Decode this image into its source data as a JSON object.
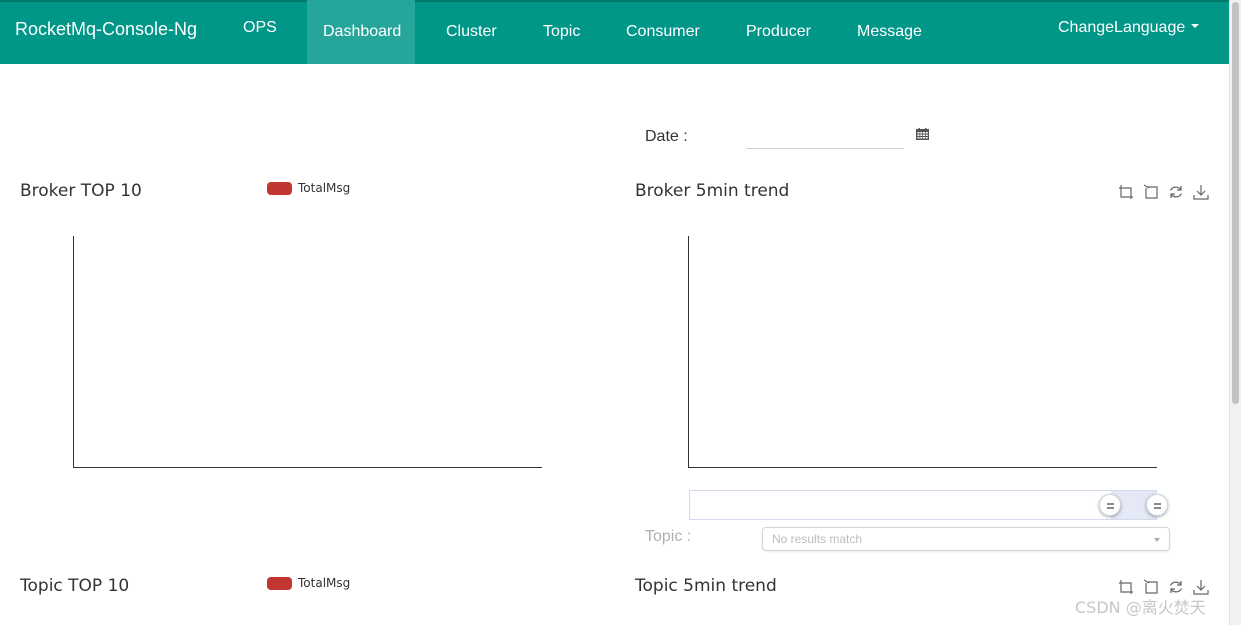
{
  "navbar": {
    "brand": "RocketMq-Console-Ng",
    "items": [
      {
        "label": "OPS"
      },
      {
        "label": "Dashboard",
        "active": true
      },
      {
        "label": "Cluster"
      },
      {
        "label": "Topic"
      },
      {
        "label": "Consumer"
      },
      {
        "label": "Producer"
      },
      {
        "label": "Message"
      }
    ],
    "language": "ChangeLanguage",
    "color": "#009688",
    "active_color": "#26a69a"
  },
  "date": {
    "label": "Date :",
    "value": "",
    "icon": "calendar-icon"
  },
  "charts": {
    "broker_top": {
      "title": "Broker TOP 10",
      "legend": "TotalMsg",
      "legend_color": "#c23531"
    },
    "broker_trend": {
      "title": "Broker 5min trend",
      "toolbox": [
        "zoom-icon",
        "zoom-reset-icon",
        "refresh-icon",
        "download-icon"
      ]
    },
    "topic_top": {
      "title": "Topic TOP 10",
      "legend": "TotalMsg",
      "legend_color": "#c23531"
    },
    "topic_trend": {
      "title": "Topic 5min trend",
      "toolbox": [
        "zoom-icon",
        "zoom-reset-icon",
        "refresh-icon",
        "download-icon"
      ]
    }
  },
  "topic_filter": {
    "label": "Topic :",
    "placeholder": "No results match"
  },
  "watermark": "CSDN @离火焚天"
}
